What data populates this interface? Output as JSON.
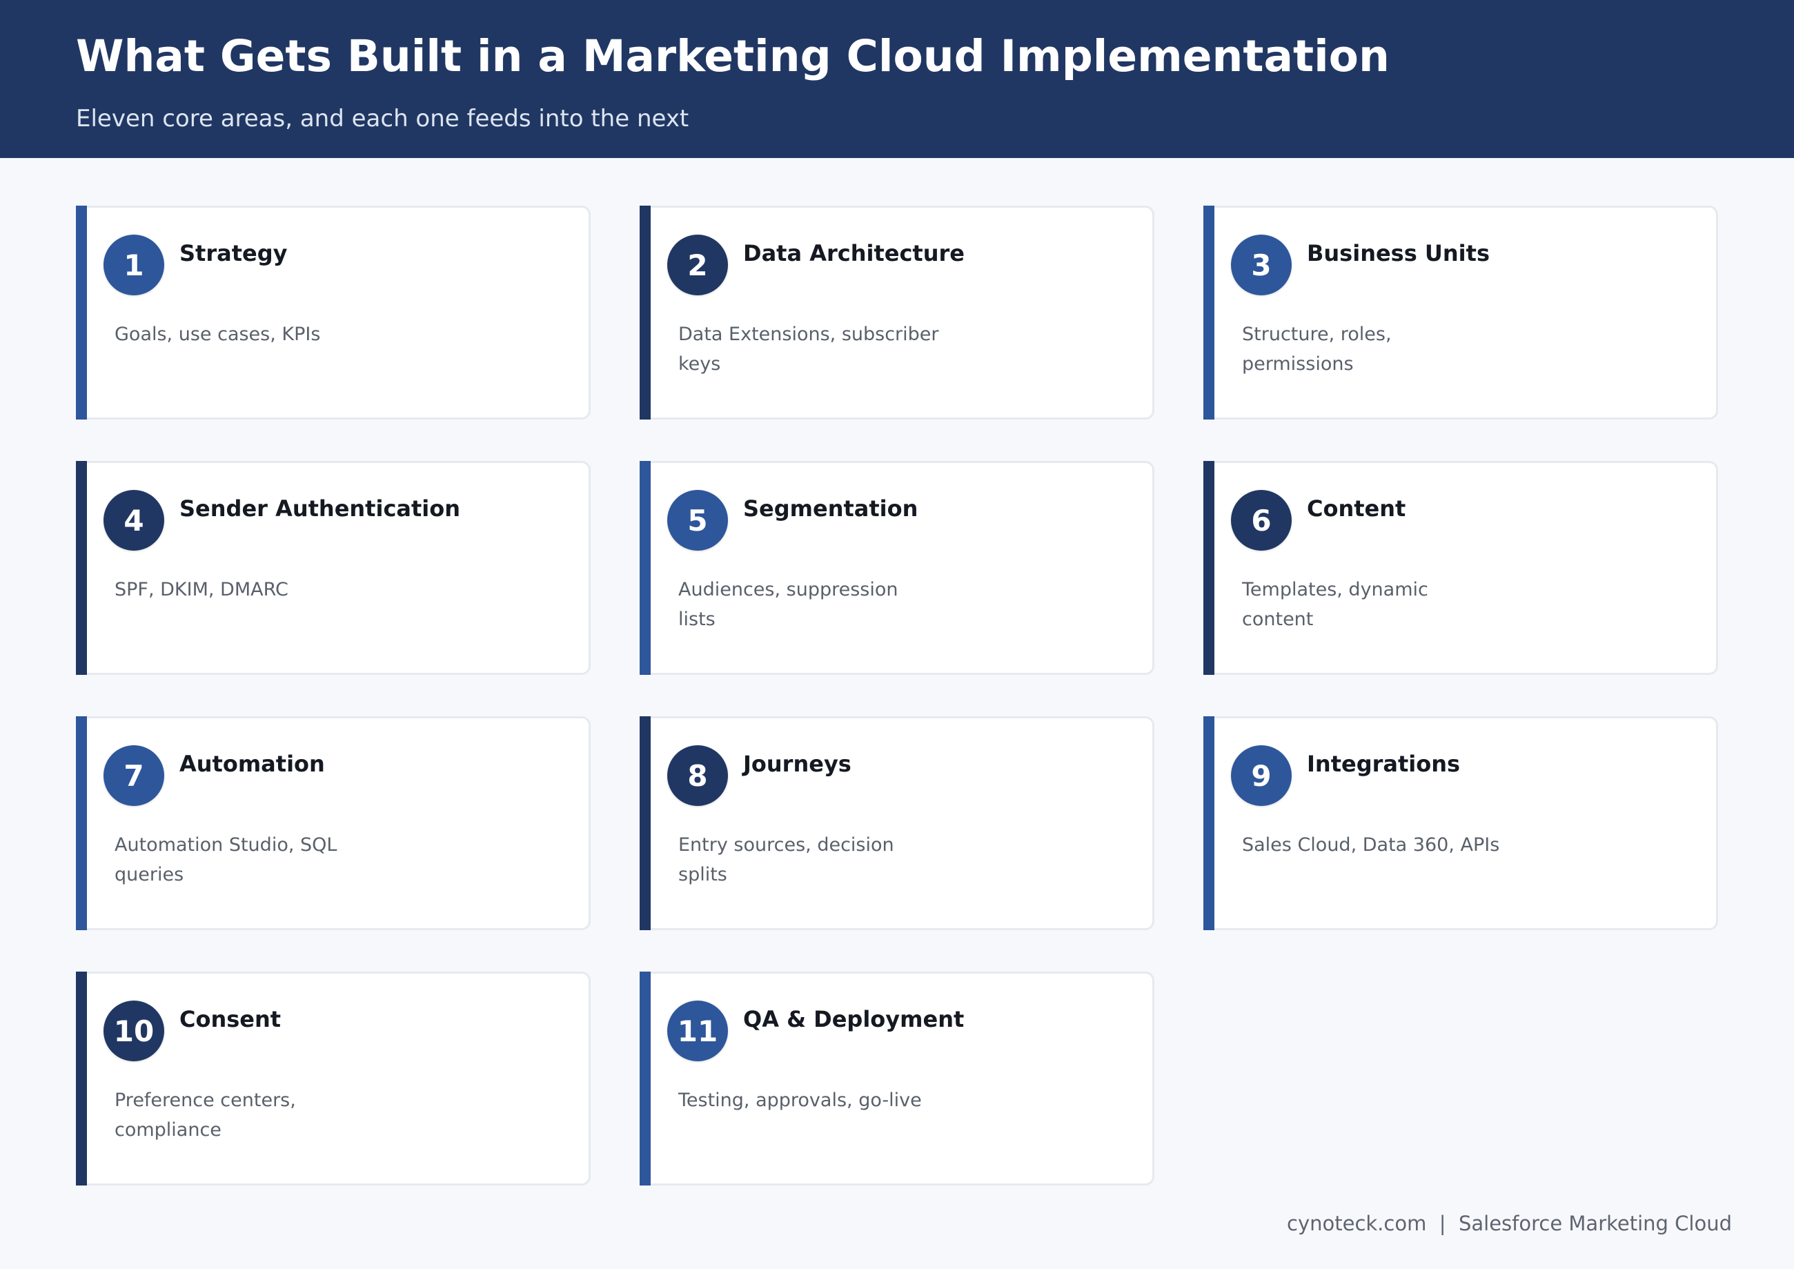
{
  "header": {
    "title": "What Gets Built in a Marketing Cloud Implementation",
    "subtitle": "Eleven core areas, and each one feeds into the next"
  },
  "colors": {
    "header_bg": "#213763",
    "accent_light": "#2e569b",
    "accent_dark": "#213763",
    "page_bg": "#f6f8fb"
  },
  "cards": [
    {
      "number": "1",
      "title": "Strategy",
      "desc": "Goals, use cases, KPIs",
      "tone": "light"
    },
    {
      "number": "2",
      "title": "Data Architecture",
      "desc": "Data Extensions, subscriber keys",
      "tone": "dark"
    },
    {
      "number": "3",
      "title": "Business Units",
      "desc": "Structure, roles, permissions",
      "tone": "light"
    },
    {
      "number": "4",
      "title": "Sender Authentication",
      "desc": "SPF, DKIM, DMARC",
      "tone": "dark"
    },
    {
      "number": "5",
      "title": "Segmentation",
      "desc": "Audiences, suppression lists",
      "tone": "light"
    },
    {
      "number": "6",
      "title": "Content",
      "desc": "Templates, dynamic content",
      "tone": "dark"
    },
    {
      "number": "7",
      "title": "Automation",
      "desc": "Automation Studio, SQL queries",
      "tone": "light"
    },
    {
      "number": "8",
      "title": "Journeys",
      "desc": "Entry sources, decision splits",
      "tone": "dark"
    },
    {
      "number": "9",
      "title": "Integrations",
      "desc": "Sales Cloud, Data 360, APIs",
      "tone": "light"
    },
    {
      "number": "10",
      "title": "Consent",
      "desc": "Preference centers, compliance",
      "tone": "dark"
    },
    {
      "number": "11",
      "title": "QA & Deployment",
      "desc": "Testing, approvals, go-live",
      "tone": "light"
    }
  ],
  "footer": {
    "text": "cynoteck.com  |  Salesforce Marketing Cloud"
  }
}
